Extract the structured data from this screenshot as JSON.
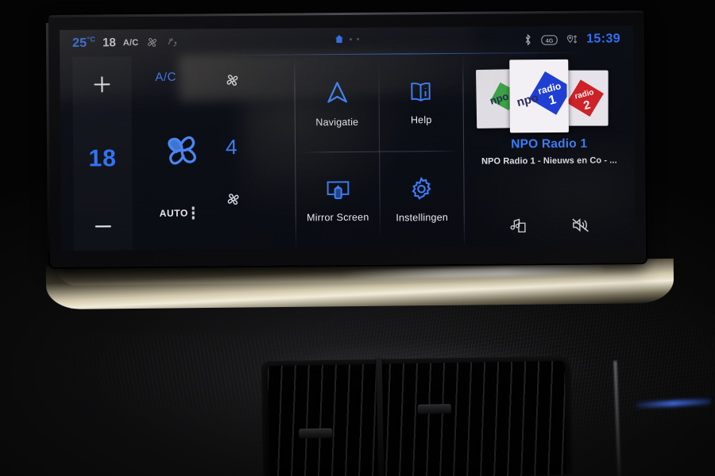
{
  "statusbar": {
    "outside_temp": "25",
    "temp_unit": "°C",
    "set_temp": "18",
    "ac_label": "A/C",
    "fan_icon": "fan-icon",
    "airflow_icon": "airflow-defrost-icon",
    "home_icon": "home-icon",
    "page_dots": 2,
    "bluetooth_icon": "bluetooth-icon",
    "network_icon": "4g-network-icon",
    "gps_icon": "gps-location-icon",
    "time": "15:39"
  },
  "climate": {
    "increase_label": "+",
    "decrease_label": "−",
    "temperature": "18",
    "ac_label": "A/C",
    "fan_speed": "4",
    "auto_label": "AUTO",
    "fan_top_icon": "fan-icon",
    "fan_main_icon": "fan-blower-icon",
    "fan_bottom_icon": "fan-icon"
  },
  "apps": [
    {
      "label": "Navigatie",
      "icon": "navigation-arrow-icon"
    },
    {
      "label": "Help",
      "icon": "book-info-icon"
    },
    {
      "label": "Mirror Screen",
      "icon": "phone-mirror-screen-icon"
    },
    {
      "label": "Instellingen",
      "icon": "gear-settings-icon"
    }
  ],
  "media": {
    "station_name": "NPO Radio 1",
    "station_info": "NPO Radio 1 - Nieuws en Co - ...",
    "source_icon": "music-source-icon",
    "mute_icon": "speaker-muted-icon",
    "presets": [
      {
        "name": "npo",
        "sub": "",
        "color": "#3fae49",
        "text": "npo",
        "active": false
      },
      {
        "name": "radio 1",
        "sub": "1",
        "color": "#1f3fd4",
        "text": "npo",
        "active": true
      },
      {
        "name": "radio 2",
        "sub": "2",
        "color": "#d8232a",
        "text": "radio",
        "active": false
      }
    ]
  },
  "colors": {
    "accent_blue": "#3a7cf8",
    "screen_bg": "#0c0e16",
    "text_light": "#e9ebf1"
  }
}
